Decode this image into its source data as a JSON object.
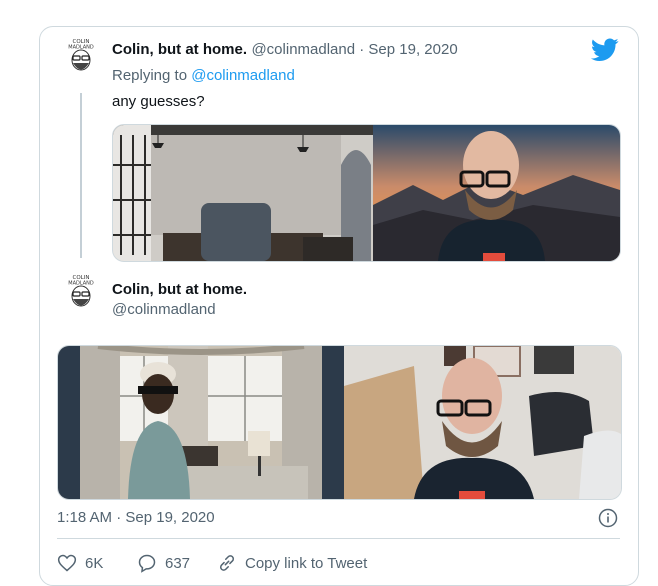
{
  "tweet1": {
    "display_name": "Colin, but at home.",
    "handle": "@colinmadland",
    "separator": " · ",
    "date": "Sep 19, 2020",
    "replying_prefix": "Replying to ",
    "replying_to": "@colinmadland",
    "text": "any guesses?"
  },
  "tweet2": {
    "display_name": "Colin, but at home.",
    "handle": "@colinmadland",
    "timestamp": "1:18 AM · Sep 19, 2020"
  },
  "avatar_text": {
    "line1": "COLIN",
    "line2": "MADLAND"
  },
  "actions": {
    "likes": "6K",
    "replies": "637",
    "copy_link": "Copy link to Tweet"
  },
  "icons": {
    "brand": "twitter-bird-icon",
    "like": "heart-icon",
    "reply": "speech-bubble-icon",
    "link": "link-icon",
    "info": "info-icon"
  },
  "colors": {
    "twitter_blue": "#1d9bf0",
    "text_secondary": "#536471",
    "border": "#cfd9de"
  }
}
